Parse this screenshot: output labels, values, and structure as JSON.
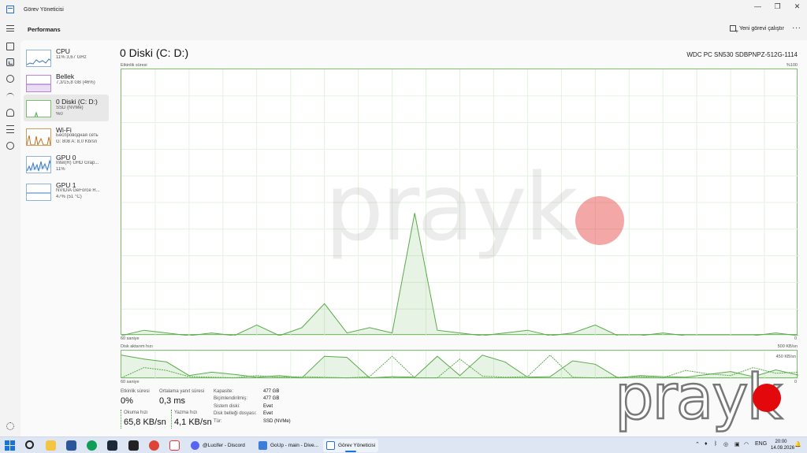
{
  "window": {
    "title": "Görev Yöneticisi",
    "controls": [
      "—",
      "❐",
      "✕"
    ]
  },
  "header": {
    "page": "Performans",
    "run_task": "Yeni görevi çalıştır",
    "more": "···"
  },
  "nav": [
    "hamburger-icon",
    "processes-icon",
    "performance-icon",
    "history-icon",
    "startup-icon",
    "users-icon",
    "details-icon",
    "services-icon",
    "settings-icon"
  ],
  "devices": [
    {
      "name": "CPU",
      "sub1": "11% 3,67 GHz",
      "sub2": ""
    },
    {
      "name": "Bellek",
      "sub1": "7,3/15,8 GB (46%)",
      "sub2": ""
    },
    {
      "name": "0 Diski (C: D:)",
      "sub1": "SSD (NVMe)",
      "sub2": "%0"
    },
    {
      "name": "Wi-Fi",
      "sub1": "Беспроводная сеть",
      "sub2": "G: 808 A: 8,0 Kb/sn"
    },
    {
      "name": "GPU 0",
      "sub1": "Intel(R) UHD Grap...",
      "sub2": "11%"
    },
    {
      "name": "GPU 1",
      "sub1": "NVIDIA GeForce R...",
      "sub2": "47% (51 °C)"
    }
  ],
  "main": {
    "title": "0 Diski (C: D:)",
    "model": "WDC PC SN530 SDBPNPZ-512G-1114",
    "activity_label": "Etkinlik süresi",
    "activity_max": "%100",
    "time_left": "60 saniye",
    "zero": "0",
    "transfer_label": "Disk aktarım hızı",
    "transfer_max": "500 KB/sn",
    "transfer_mid": "450 KB/sn"
  },
  "stats": {
    "active_time_label": "Etkinlik süresi",
    "active_time_value": "0%",
    "avg_response_label": "Ortalama yanıt süresi",
    "avg_response_value": "0,3 ms",
    "read_label": "Okuma hızı",
    "read_value": "65,8 KB/sn",
    "write_label": "Yazma hızı",
    "write_value": "4,1 KB/sn"
  },
  "properties": [
    {
      "key": "Kapasite:",
      "value": "477 GB"
    },
    {
      "key": "Biçimlendirilmiş:",
      "value": "477 GB"
    },
    {
      "key": "Sistem diski:",
      "value": "Evet"
    },
    {
      "key": "Disk belleği dosyası:",
      "value": "Evet"
    },
    {
      "key": "Tür:",
      "value": "SSD (NVMe)"
    }
  ],
  "chart_data": [
    {
      "type": "area",
      "title": "Etkinlik süresi",
      "x": [
        0,
        2,
        4,
        6,
        8,
        10,
        12,
        14,
        16,
        18,
        20,
        22,
        24,
        26,
        28,
        30,
        32,
        34,
        36,
        38,
        40,
        42,
        44,
        46,
        48,
        50,
        52,
        54,
        56,
        58,
        60
      ],
      "values": [
        0,
        2,
        1,
        0,
        1,
        0,
        4,
        0,
        3,
        12,
        1,
        3,
        1,
        46,
        2,
        1,
        0,
        1,
        2,
        0,
        1,
        4,
        0,
        0,
        1,
        0,
        0,
        0,
        0,
        1,
        0
      ],
      "xlabel": "60 saniye",
      "ylim": [
        0,
        100
      ]
    },
    {
      "type": "line",
      "title": "Disk aktarım hızı",
      "x": [
        0,
        2,
        4,
        6,
        8,
        10,
        12,
        14,
        16,
        18,
        20,
        22,
        24,
        26,
        28,
        30,
        32,
        34,
        36,
        38,
        40,
        42,
        44,
        46,
        48,
        50,
        52,
        54,
        56,
        58,
        60
      ],
      "series": [
        {
          "values": [
            420,
            350,
            300,
            60,
            120,
            80,
            30,
            60,
            20,
            400,
            380,
            20,
            40,
            30,
            400,
            60,
            420,
            300,
            30,
            40,
            320,
            260,
            20,
            60,
            40,
            30,
            80,
            130,
            40,
            160,
            70
          ]
        },
        {
          "values": [
            20,
            200,
            150,
            40,
            30,
            20,
            60,
            30,
            40,
            30,
            20,
            40,
            400,
            20,
            20,
            350,
            50,
            30,
            40,
            420,
            30,
            20,
            30,
            40,
            20,
            150,
            90,
            60,
            200,
            100,
            120
          ]
        }
      ],
      "xlabel": "60 saniye",
      "ylim": [
        0,
        500
      ]
    }
  ],
  "watermark": "prayk",
  "taskbar": {
    "apps": [
      "@Lucifer - Discord",
      "GoUp - main - Dive...",
      "Görev Yöneticisi"
    ],
    "lang": "ENG",
    "time": "20:00",
    "date": "14.09.2026"
  }
}
